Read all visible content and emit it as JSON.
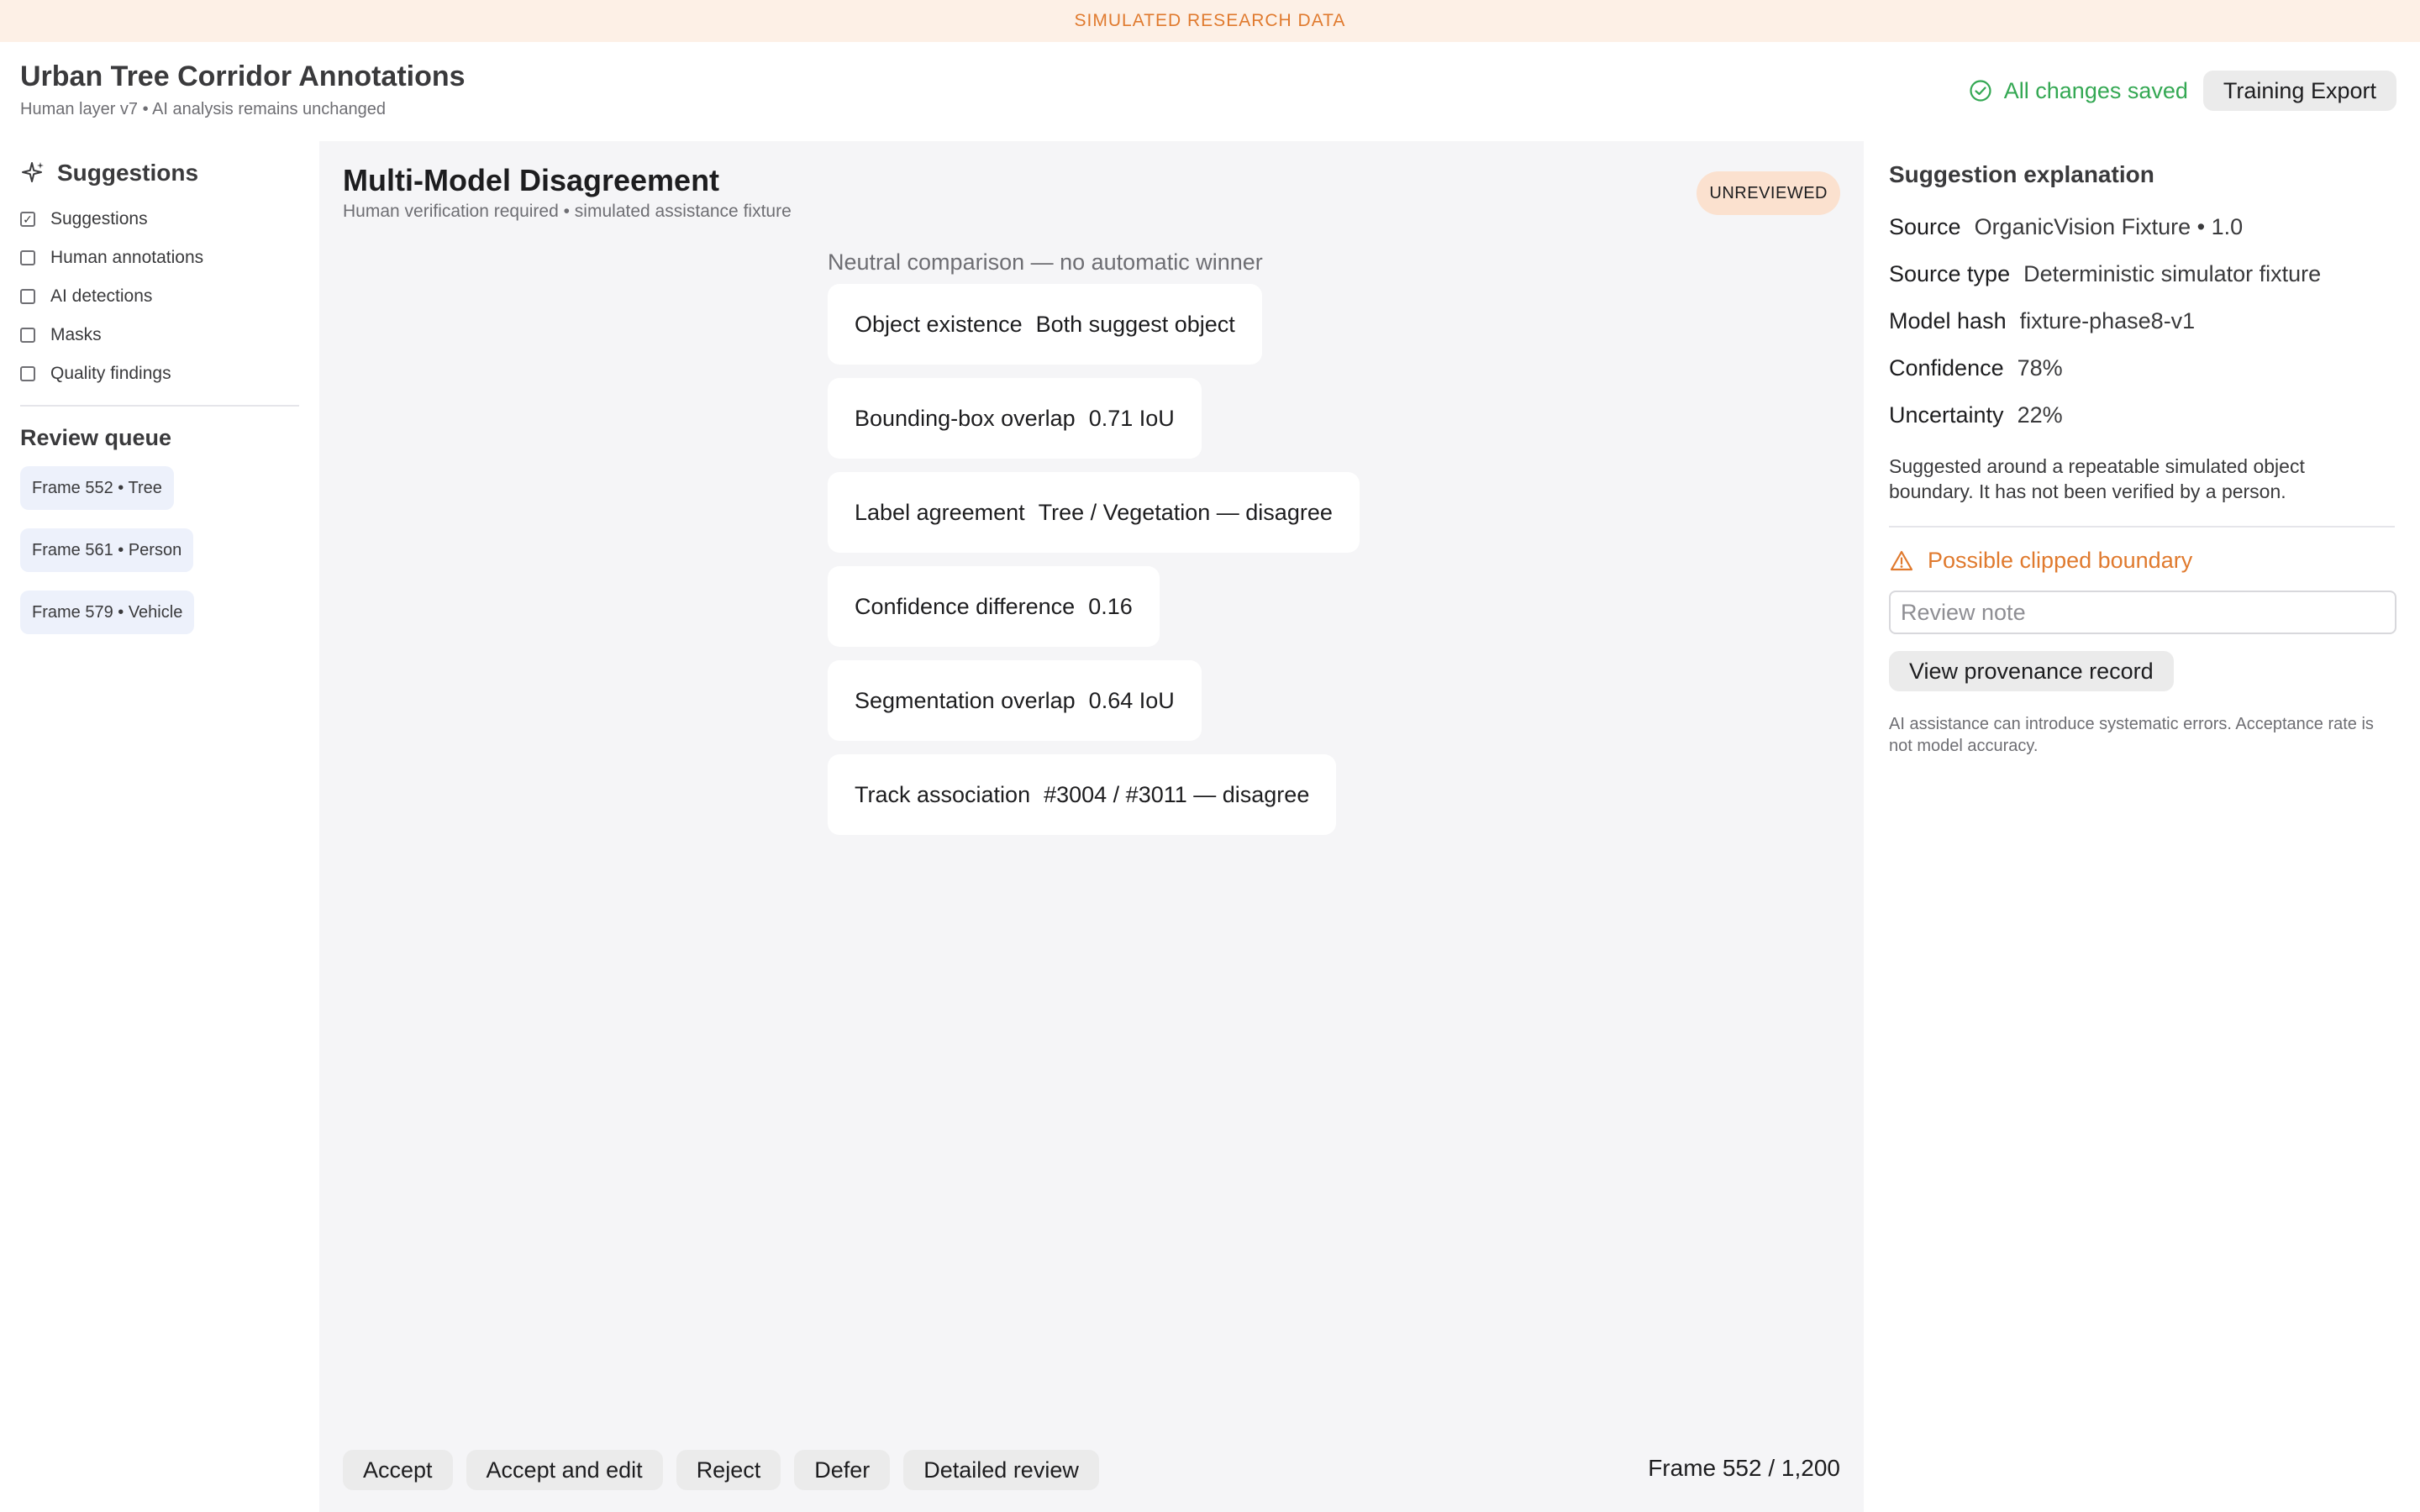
{
  "banner": "SIMULATED RESEARCH DATA",
  "header": {
    "title": "Urban Tree Corridor Annotations",
    "subtitle": "Human layer v7 • AI analysis remains unchanged",
    "save_status": "All changes saved",
    "export_label": "Training Export"
  },
  "sidebar": {
    "layers_title": "Suggestions",
    "layers": [
      {
        "label": "Suggestions",
        "checked": true
      },
      {
        "label": "Human annotations",
        "checked": false
      },
      {
        "label": "AI detections",
        "checked": false
      },
      {
        "label": "Masks",
        "checked": false
      },
      {
        "label": "Quality findings",
        "checked": false
      }
    ],
    "queue_title": "Review queue",
    "queue": [
      {
        "label": "Frame 552 • Tree"
      },
      {
        "label": "Frame 561 • Person"
      },
      {
        "label": "Frame 579 • Vehicle"
      }
    ]
  },
  "main": {
    "title": "Multi-Model Disagreement",
    "subtitle": "Human verification required • simulated assistance fixture",
    "status_badge": "UNREVIEWED",
    "comparison_caption": "Neutral comparison — no automatic winner",
    "metrics": [
      {
        "label": "Object existence",
        "value": "Both suggest object"
      },
      {
        "label": "Bounding-box overlap",
        "value": "0.71 IoU"
      },
      {
        "label": "Label agreement",
        "value": "Tree / Vegetation — disagree"
      },
      {
        "label": "Confidence difference",
        "value": "0.16"
      },
      {
        "label": "Segmentation overlap",
        "value": "0.64 IoU"
      },
      {
        "label": "Track association",
        "value": "#3004 / #3011 — disagree"
      }
    ],
    "actions": {
      "accept": "Accept",
      "accept_edit": "Accept and edit",
      "reject": "Reject",
      "defer": "Defer",
      "detailed": "Detailed review"
    },
    "frame_counter": "Frame 552 / 1,200"
  },
  "detail": {
    "title": "Suggestion explanation",
    "rows": [
      {
        "key": "Source",
        "value": "OrganicVision Fixture • 1.0"
      },
      {
        "key": "Source type",
        "value": "Deterministic simulator fixture"
      },
      {
        "key": "Model hash",
        "value": "fixture-phase8-v1"
      },
      {
        "key": "Confidence",
        "value": "78%"
      },
      {
        "key": "Uncertainty",
        "value": "22%"
      }
    ],
    "explanation": "Suggested around a repeatable simulated object boundary. It has not been verified by a person.",
    "warning": "Possible clipped boundary",
    "note_placeholder": "Review note",
    "provenance_label": "View provenance record",
    "disclaimer": "AI assistance can introduce systematic errors. Acceptance rate is not model accuracy."
  },
  "colors": {
    "accent_orange": "#e07a2e",
    "success_green": "#34a853",
    "banner_bg": "#fdf0e6",
    "badge_bg": "#fbe1cf",
    "chip_bg": "#edf1fb"
  }
}
